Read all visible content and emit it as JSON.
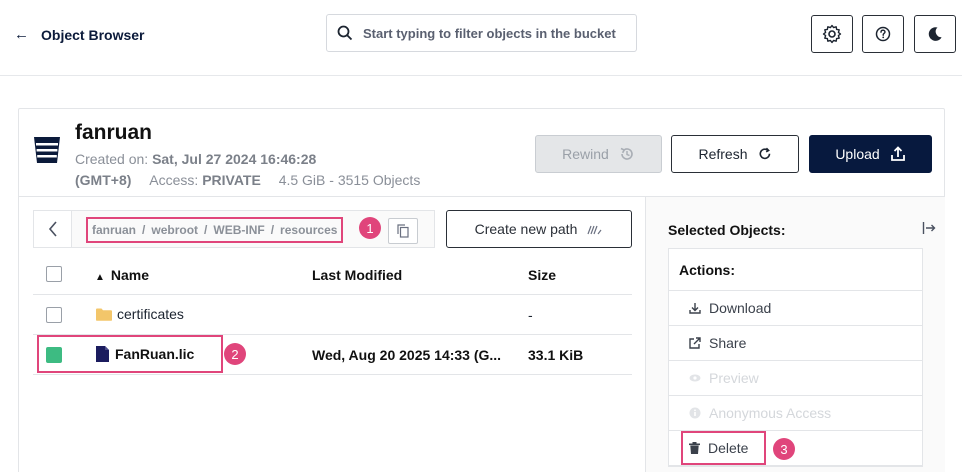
{
  "topbar": {
    "back_label": "Object Browser",
    "search_placeholder": "Start typing to filter objects in the bucket",
    "icons": [
      "settings-icon",
      "help-icon",
      "dark-mode-icon"
    ]
  },
  "bucket": {
    "name": "fanruan",
    "created_label": "Created on:",
    "created_value": "Sat, Jul 27 2024 16:46:28",
    "timezone": "(GMT+8)",
    "access_label": "Access:",
    "access_value": "PRIVATE",
    "usage": "4.5 GiB - 3515 Objects"
  },
  "header_buttons": {
    "rewind": "Rewind",
    "refresh": "Refresh",
    "upload": "Upload"
  },
  "breadcrumb": {
    "parts": [
      "fanruan",
      "webroot",
      "WEB-INF",
      "resources"
    ],
    "separator": "/"
  },
  "create_path_label": "Create new path",
  "table": {
    "columns": [
      "Name",
      "Last Modified",
      "Size"
    ],
    "rows": [
      {
        "name": "certificates",
        "type": "folder",
        "modified": "",
        "size": "-",
        "selected": false
      },
      {
        "name": "FanRuan.lic",
        "type": "file",
        "modified": "Wed, Aug 20 2025 14:33 (G...",
        "size": "33.1 KiB",
        "selected": true
      }
    ]
  },
  "panel": {
    "title": "Selected Objects:",
    "actions_label": "Actions:",
    "actions": [
      {
        "label": "Download",
        "enabled": true
      },
      {
        "label": "Share",
        "enabled": true
      },
      {
        "label": "Preview",
        "enabled": false
      },
      {
        "label": "Anonymous Access",
        "enabled": false
      },
      {
        "label": "Delete",
        "enabled": true
      }
    ]
  },
  "annotations": [
    "1",
    "2",
    "3"
  ],
  "colors": {
    "highlight": "#e0457b",
    "upload_bg": "#07193e",
    "checkbox_on": "#3dbb82",
    "folder": "#f3c66a",
    "file": "#1b1c5e"
  }
}
